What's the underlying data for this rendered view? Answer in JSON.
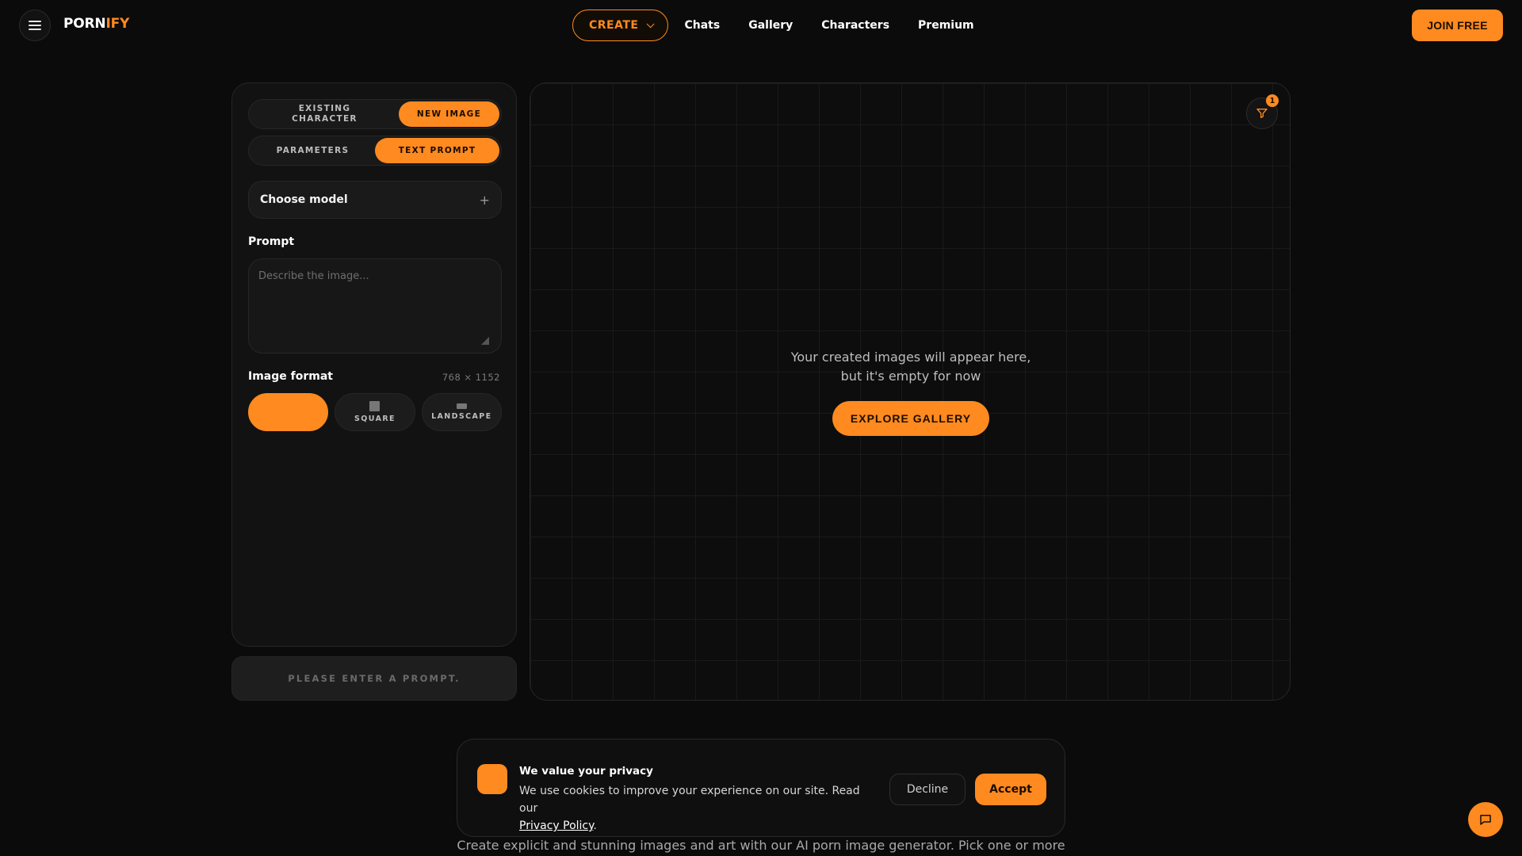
{
  "brand": {
    "logo_part1": "PORN",
    "logo_part2": "IFY"
  },
  "nav": {
    "create_label": "CREATE",
    "links": [
      "Chats",
      "Gallery",
      "Characters",
      "Premium"
    ],
    "join_label": "JOIN FREE"
  },
  "left_panel": {
    "source_tabs": [
      "EXISTING CHARACTER",
      "NEW IMAGE"
    ],
    "source_active": "NEW IMAGE",
    "mode_tabs": [
      "PARAMETERS",
      "TEXT PROMPT"
    ],
    "mode_active": "TEXT PROMPT",
    "model_select_label": "Choose model",
    "prompt_title": "Prompt",
    "prompt_placeholder": "Describe the image...",
    "prompt_value": "",
    "format_title": "Image format",
    "format_dims": "768 × 1152",
    "formats": [
      "",
      "SQUARE",
      "LANDSCAPE"
    ],
    "generate_label": "PLEASE ENTER A PROMPT."
  },
  "gallery": {
    "filter_count": "1",
    "empty_line1": "Your created images will appear here,",
    "empty_line2": "but it's empty for now",
    "explore_label": "EXPLORE GALLERY"
  },
  "cookie": {
    "title": "We value your privacy",
    "text": "We use cookies to improve your experience on our site. Read our",
    "link": "Privacy Policy",
    "period": ".",
    "decline": "Decline",
    "accept": "Accept"
  },
  "footer": {
    "description": "Create explicit and stunning images and art with our AI porn image generator. Pick one or more"
  },
  "colors": {
    "accent": "#ff8a1f",
    "background": "#0b0b0b",
    "panel": "#121212"
  }
}
